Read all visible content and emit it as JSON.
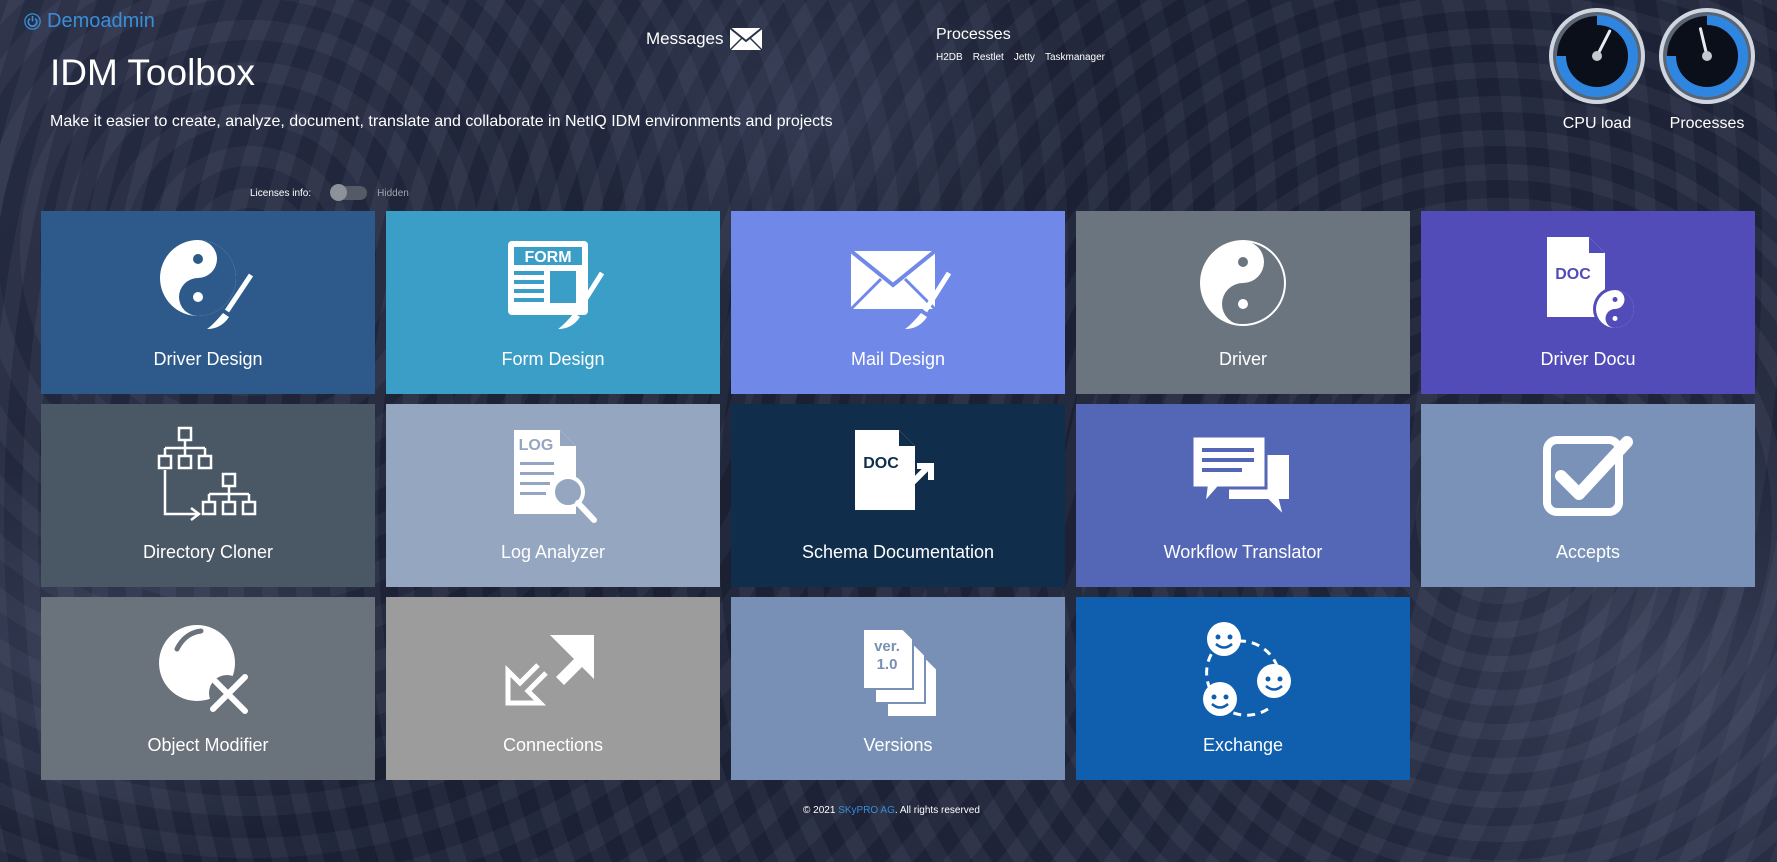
{
  "header": {
    "user": "Demoadmin",
    "title": "IDM Toolbox",
    "subtitle": "Make it easier to create, analyze, document, translate and collaborate in NetIQ IDM environments and projects",
    "messages_label": "Messages",
    "processes": {
      "title": "Processes",
      "links": [
        "H2DB",
        "Restlet",
        "Jetty",
        "Taskmanager"
      ]
    },
    "gauges": [
      {
        "label": "CPU load",
        "level": 0.6
      },
      {
        "label": "Processes",
        "level": 0.45
      }
    ]
  },
  "licenses": {
    "label": "Licenses info:",
    "state": "Hidden"
  },
  "tiles": [
    {
      "label": "Driver Design",
      "icon": "yin-yang-brush-icon",
      "color": "#2d5a8a"
    },
    {
      "label": "Form Design",
      "icon": "form-brush-icon",
      "color": "#3a9ec6"
    },
    {
      "label": "Mail Design",
      "icon": "mail-brush-icon",
      "color": "#7088e8"
    },
    {
      "label": "Driver",
      "icon": "yin-yang-icon",
      "color": "#6b7580"
    },
    {
      "label": "Driver Docu",
      "icon": "doc-yin-yang-icon",
      "color": "#514cb8"
    },
    {
      "label": "Directory Cloner",
      "icon": "tree-clone-icon",
      "color": "#4a5866"
    },
    {
      "label": "Log Analyzer",
      "icon": "log-search-icon",
      "color": "#95a6c0"
    },
    {
      "label": "Schema Documentation",
      "icon": "doc-export-icon",
      "color": "#102e4c"
    },
    {
      "label": "Workflow Translator",
      "icon": "chat-bubbles-icon",
      "color": "#5466b6"
    },
    {
      "label": "Accepts",
      "icon": "checkbox-icon",
      "color": "#7b92b8"
    },
    {
      "label": "Object Modifier",
      "icon": "sphere-tools-icon",
      "color": "#6a727c"
    },
    {
      "label": "Connections",
      "icon": "arrows-expand-icon",
      "color": "#9c9c9c"
    },
    {
      "label": "Versions",
      "icon": "versions-icon",
      "color": "#7890b6"
    },
    {
      "label": "Exchange",
      "icon": "people-exchange-icon",
      "color": "#0f5fae"
    }
  ],
  "footer": {
    "prefix": "© 2021 ",
    "company": "SKyPRO AG",
    "suffix": ". All rights reserved"
  }
}
